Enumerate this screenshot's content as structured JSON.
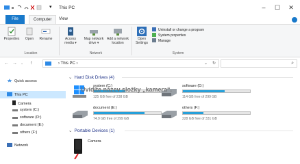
{
  "window": {
    "title": "This PC",
    "controls": {
      "minimize": "–",
      "maximize": "☐",
      "close": "✕"
    }
  },
  "ribbon": {
    "tabs": {
      "file": "File",
      "computer": "Computer",
      "view": "View"
    },
    "location": {
      "label": "Location",
      "properties": "Properties",
      "open": "Open",
      "rename": "Rename"
    },
    "network": {
      "label": "Network",
      "access_media": "Access media ▾",
      "map_drive": "Map network drive ▾",
      "add_location": "Add a network location"
    },
    "system": {
      "label": "System",
      "open_settings": "Open Settings",
      "uninstall": "Uninstall or change a program",
      "system_properties": "System properties",
      "manage": "Manage"
    }
  },
  "address": {
    "path": "› This PC ›",
    "back": "←",
    "forward": "→",
    "up": "↑",
    "dropdown": "⌄",
    "refresh": "↻",
    "search_icon": "⌕"
  },
  "nav": {
    "quick_access": "Quick access",
    "this_pc": "This PC",
    "camera": "Camera",
    "system_c": "system (C:)",
    "software_d": "software (D:)",
    "document_e": "document (E:)",
    "others_f": "others (F:)",
    "network": "Network"
  },
  "content": {
    "hdd_header": "Hard Disk Drives (4)",
    "portable_header": "Portable Devices (1)",
    "drives": [
      {
        "name": "system (C:)",
        "free": "125 GB free of 238 GB",
        "used_fraction": 0.47
      },
      {
        "name": "software (D:)",
        "free": "114 GB free of 299 GB",
        "used_fraction": 0.62
      },
      {
        "name": "document (E:)",
        "free": "74.9 GB free of 299 GB",
        "used_fraction": 0.75
      },
      {
        "name": "others (F:)",
        "free": "228 GB free of 331 GB",
        "used_fraction": 0.31
      }
    ],
    "camera_label": "Camera"
  },
  "caption": "Uvidíte název složky „kamera“.",
  "colors": {
    "accent": "#1979ca",
    "bar_fill": "#26a0da",
    "caption": "#777777"
  }
}
